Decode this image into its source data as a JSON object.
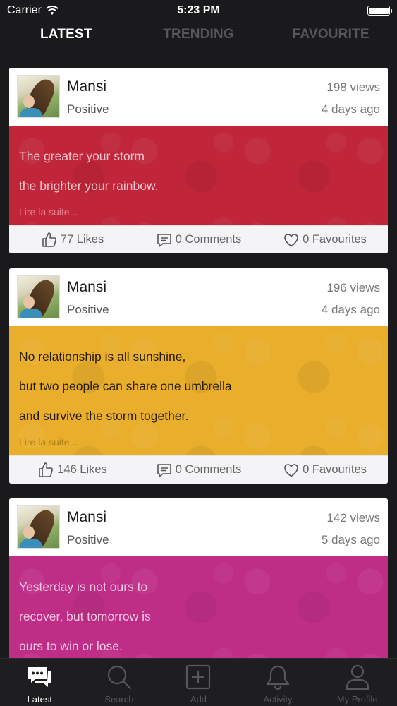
{
  "status_bar": {
    "carrier": "Carrier",
    "time": "5:23 PM",
    "battery_level": 1.0
  },
  "tabs": [
    {
      "label": "LATEST",
      "active": true
    },
    {
      "label": "TRENDING",
      "active": false
    },
    {
      "label": "FAVOURITE",
      "active": false
    }
  ],
  "posts": [
    {
      "author": "Mansi",
      "category": "Positive",
      "views": "198 views",
      "time_ago": "4 days ago",
      "color": "#c0253a",
      "lines": [
        "The greater your storm",
        "the brighter your rainbow."
      ],
      "read_more": "Lire la suite...",
      "likes": "77 Likes",
      "comments": "0 Comments",
      "favourites": "0 Favourites"
    },
    {
      "author": "Mansi",
      "category": "Positive",
      "views": "196 views",
      "time_ago": "4 days ago",
      "color": "#e8ae2c",
      "lines": [
        "No relationship is all sunshine,",
        "but two people can share one umbrella",
        "and survive the storm together."
      ],
      "read_more": "Lire la suite...",
      "likes": "146 Likes",
      "comments": "0 Comments",
      "favourites": "0 Favourites"
    },
    {
      "author": "Mansi",
      "category": "Positive",
      "views": "142 views",
      "time_ago": "5 days ago",
      "color": "#be2d86",
      "lines": [
        "Yesterday is not ours to",
        "recover,  but tomorrow is",
        "ours to win or lose."
      ]
    }
  ],
  "tabbar": [
    {
      "label": "Latest",
      "icon": "chat-bubbles-icon",
      "active": true
    },
    {
      "label": "Search",
      "icon": "search-icon",
      "active": false
    },
    {
      "label": "Add",
      "icon": "add-square-icon",
      "active": false
    },
    {
      "label": "Activity",
      "icon": "bell-icon",
      "active": false
    },
    {
      "label": "My Profile",
      "icon": "person-icon",
      "active": false
    }
  ]
}
